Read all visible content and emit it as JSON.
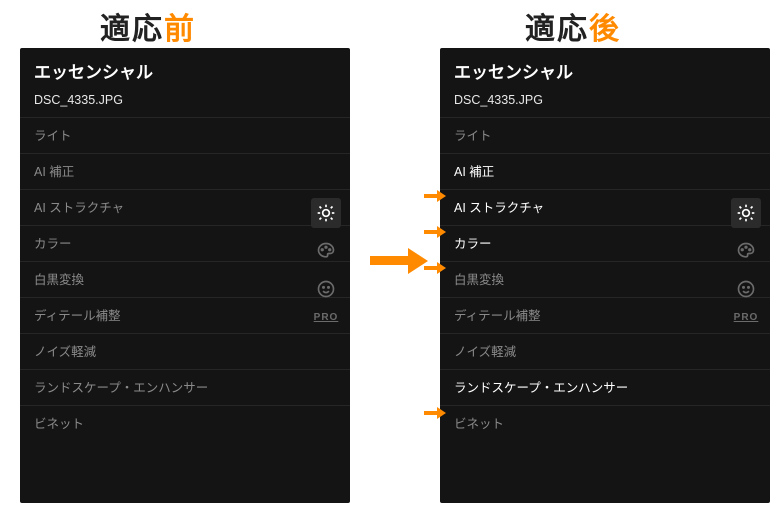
{
  "headings": {
    "left_prefix": "適応",
    "left_accent": "前",
    "right_prefix": "適応",
    "right_accent": "後"
  },
  "panel": {
    "title": "エッセンシャル",
    "filename": "DSC_4335.JPG"
  },
  "rows": {
    "light": "ライト",
    "ai_correction": "AI 補正",
    "ai_structure": "AI ストラクチャ",
    "color": "カラー",
    "bw": "白黒変換",
    "detail": "ディテール補整",
    "noise": "ノイズ軽減",
    "landscape": "ランドスケープ・エンハンサー",
    "vignette": "ビネット"
  },
  "rail": {
    "pro": "PRO"
  },
  "icons": {
    "brightness": "brightness-icon",
    "palette": "palette-icon",
    "face": "face-icon"
  }
}
